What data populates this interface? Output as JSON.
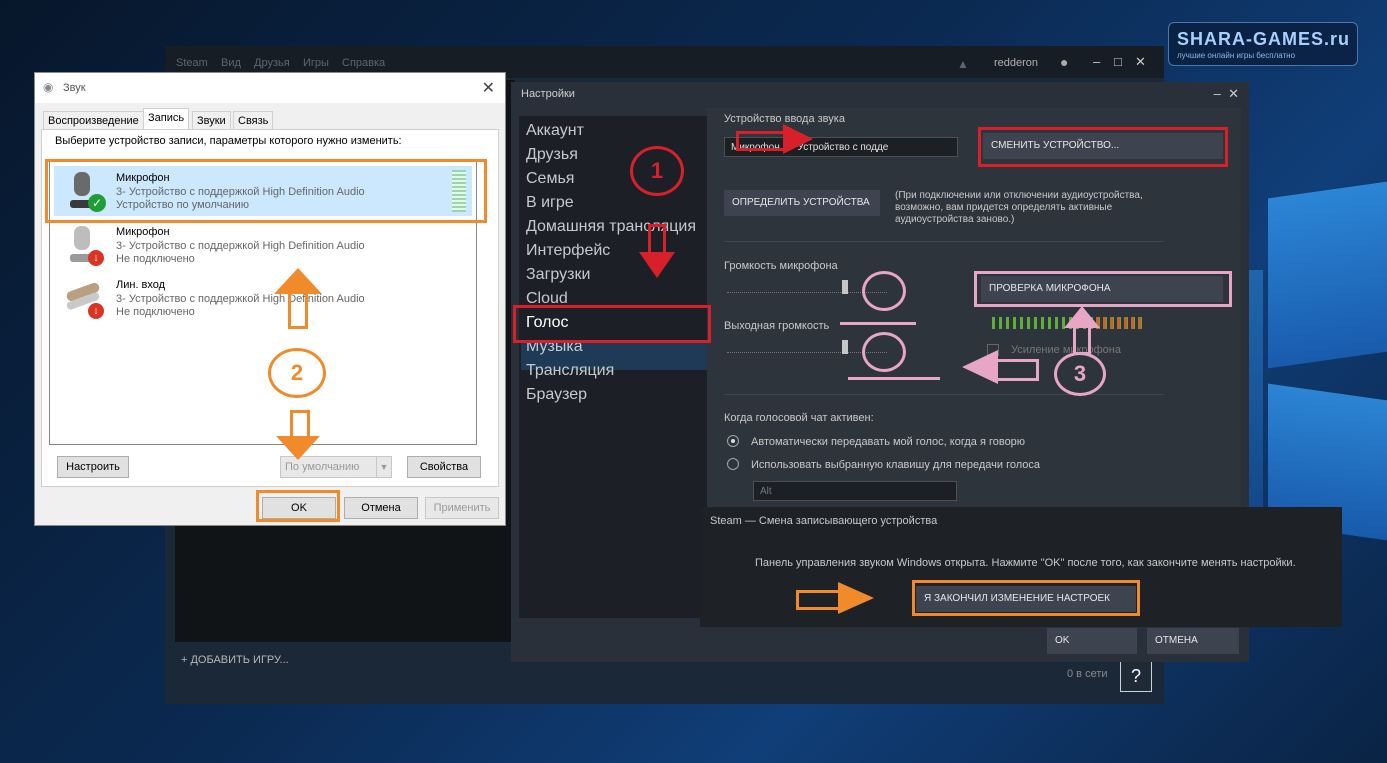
{
  "watermark": {
    "brand": "SHARA-GAMES.ru",
    "tagline": "лучшие онлайн игры бесплатно"
  },
  "steam_main": {
    "menu": [
      "Steam",
      "Вид",
      "Друзья",
      "Игры",
      "Справка"
    ],
    "username": "redderon",
    "add_game": "ДОБАВИТЬ ИГРУ...",
    "online": "0 в сети",
    "help": "?"
  },
  "sound_dialog": {
    "title": "Звук",
    "tabs": [
      "Воспроизведение",
      "Запись",
      "Звуки",
      "Связь"
    ],
    "active_tab": "Запись",
    "instruction": "Выберите устройство записи, параметры которого нужно изменить:",
    "devices": [
      {
        "name": "Микрофон",
        "desc": "3- Устройство с поддержкой High Definition Audio",
        "status": "Устройство по умолчанию",
        "selected": true,
        "icon": "microphone-icon",
        "badge": "check-badge-icon"
      },
      {
        "name": "Микрофон",
        "desc": "3- Устройство с поддержкой High Definition Audio",
        "status": "Не подключено",
        "selected": false,
        "icon": "microphone-icon",
        "badge": "disconnected-arrow-icon"
      },
      {
        "name": "Лин. вход",
        "desc": "3- Устройство с поддержкой High Definition Audio",
        "status": "Не подключено",
        "selected": false,
        "icon": "line-in-cable-icon",
        "badge": "disconnected-arrow-icon"
      }
    ],
    "buttons": {
      "configure": "Настроить",
      "default": "По умолчанию",
      "properties": "Свойства",
      "ok": "OK",
      "cancel": "Отмена",
      "apply": "Применить"
    }
  },
  "settings": {
    "title": "Настройки",
    "nav": [
      "Аккаунт",
      "Друзья",
      "Семья",
      "В игре",
      "Домашняя трансляция",
      "Интерфейс",
      "Загрузки",
      "Cloud",
      "Голос",
      "Музыка",
      "Трансляция",
      "Браузер"
    ],
    "nav_selected": "Голос",
    "input_device_label": "Устройство ввода звука",
    "input_device_value": "Микрофон (3- Устройство с подде",
    "change_device": "СМЕНИТЬ УСТРОЙСТВО...",
    "detect_devices": "ОПРЕДЕЛИТЬ УСТРОЙСТВА",
    "detect_note": "(При подключении или отключении аудиоустройства, возможно, вам придется определять активные аудиоустройства заново.)",
    "mic_volume_label": "Громкость микрофона",
    "mic_volume": 0.72,
    "output_volume_label": "Выходная громкость",
    "output_volume": 0.72,
    "mic_test": "ПРОВЕРКА МИКРОФОНА",
    "mic_boost": "Усиление микрофона",
    "voice_active_label": "Когда голосовой чат активен:",
    "radio_auto": "Автоматически передавать мой голос, когда я говорю",
    "radio_key": "Использовать выбранную клавишу для передачи голоса",
    "key_value": "Alt",
    "ok": "OK",
    "cancel": "ОТМЕНА"
  },
  "popup": {
    "title": "Steam — Смена записывающего устройства",
    "message": "Панель управления звуком Windows открыта. Нажмите \"OK\" после того, как закончите менять настройки.",
    "done_button": "Я ЗАКОНЧИЛ ИЗМЕНЕНИЕ НАСТРОЕК"
  },
  "annotations": {
    "step1": "1",
    "step2": "2",
    "step3": "3"
  },
  "colors": {
    "red": "#d8202a",
    "orange": "#f08a2a",
    "pink": "#e8a6c6",
    "steam_bg": "#1b2838",
    "nav_selected": "#1e3a56"
  }
}
